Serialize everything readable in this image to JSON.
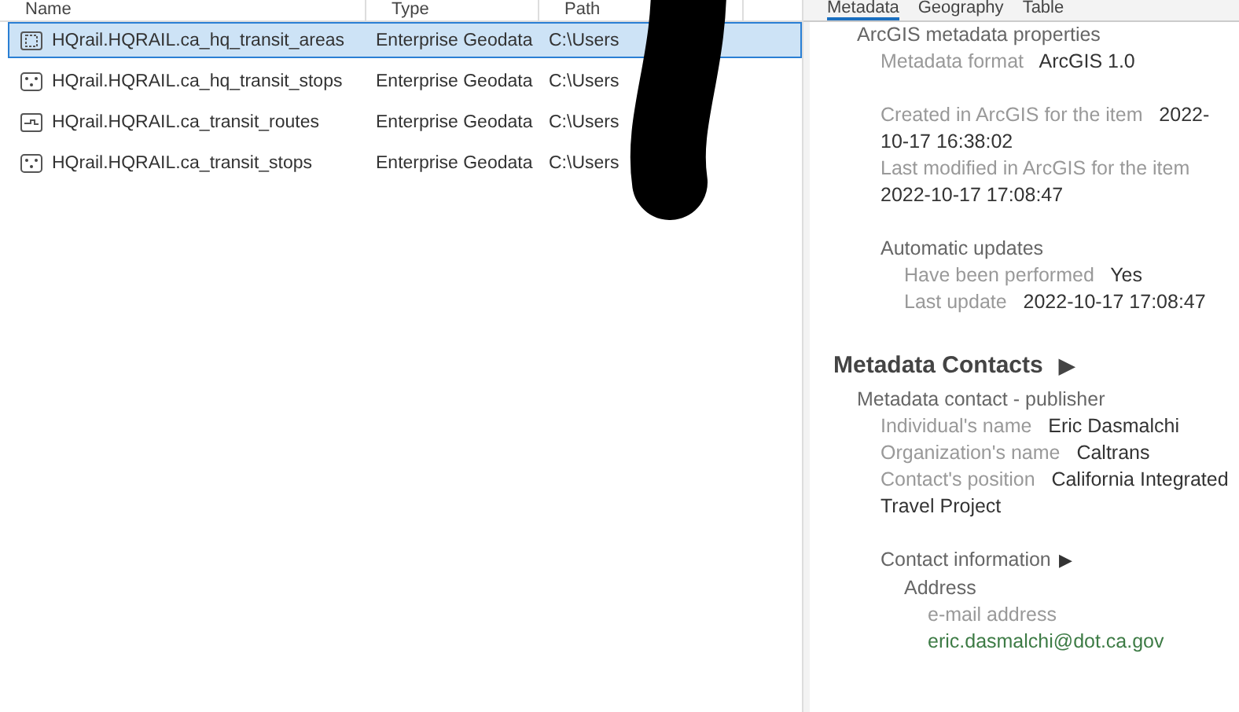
{
  "table": {
    "columns": [
      "Name",
      "Type",
      "Path"
    ],
    "rows": [
      {
        "kind": "polygon",
        "name": "HQrail.HQRAIL.ca_hq_transit_areas",
        "type": "Enterprise Geodata",
        "path": "C:\\Users",
        "selected": true
      },
      {
        "kind": "point",
        "name": "HQrail.HQRAIL.ca_hq_transit_stops",
        "type": "Enterprise Geodata",
        "path": "C:\\Users",
        "selected": false
      },
      {
        "kind": "line",
        "name": "HQrail.HQRAIL.ca_transit_routes",
        "type": "Enterprise Geodata",
        "path": "C:\\Users",
        "selected": false
      },
      {
        "kind": "point",
        "name": "HQrail.HQRAIL.ca_transit_stops",
        "type": "Enterprise Geodata",
        "path": "C:\\Users",
        "selected": false
      }
    ]
  },
  "metadata_panel": {
    "tabs": [
      {
        "label": "Metadata",
        "selected": true
      },
      {
        "label": "Geography",
        "selected": false
      },
      {
        "label": "Table",
        "selected": false
      }
    ],
    "sections": [
      {
        "children": [
          {
            "kind": "group",
            "title": "ArcGIS metadata properties",
            "children": [
              {
                "kind": "group",
                "children": [
                  {
                    "kind": "field",
                    "label": "Metadata format",
                    "value": "ArcGIS 1.0"
                  }
                ]
              },
              {
                "kind": "group",
                "children": [
                  {
                    "kind": "field",
                    "label": "Created in ArcGIS for the item",
                    "value": "2022-10-17 16:38:02"
                  },
                  {
                    "kind": "field",
                    "label": "Last modified in ArcGIS for the item",
                    "value": "2022-10-17 17:08:47"
                  }
                ]
              },
              {
                "kind": "group",
                "title": "Automatic updates",
                "children": [
                  {
                    "kind": "field",
                    "label": "Have been performed",
                    "value": "Yes"
                  },
                  {
                    "kind": "field",
                    "label": "Last update",
                    "value": "2022-10-17 17:08:47"
                  }
                ]
              }
            ]
          }
        ]
      },
      {
        "title": "Metadata Contacts",
        "toggle": "▶",
        "children": [
          {
            "kind": "group",
            "title": "Metadata contact - publisher",
            "children": [
              {
                "kind": "field",
                "label": "Individual's name",
                "value": "Eric Dasmalchi"
              },
              {
                "kind": "field",
                "label": "Organization's name",
                "value": "Caltrans"
              },
              {
                "kind": "field",
                "label": "Contact's position",
                "value": "California Integrated Travel Project"
              },
              {
                "kind": "group",
                "title": "Contact information",
                "toggle": "▶",
                "children": [
                  {
                    "kind": "group",
                    "title": "Address",
                    "children": [
                      {
                        "kind": "email",
                        "label": "e-mail address",
                        "value": "eric.dasmalchi@dot.ca.gov"
                      }
                    ]
                  }
                ]
              }
            ]
          }
        ]
      }
    ]
  }
}
